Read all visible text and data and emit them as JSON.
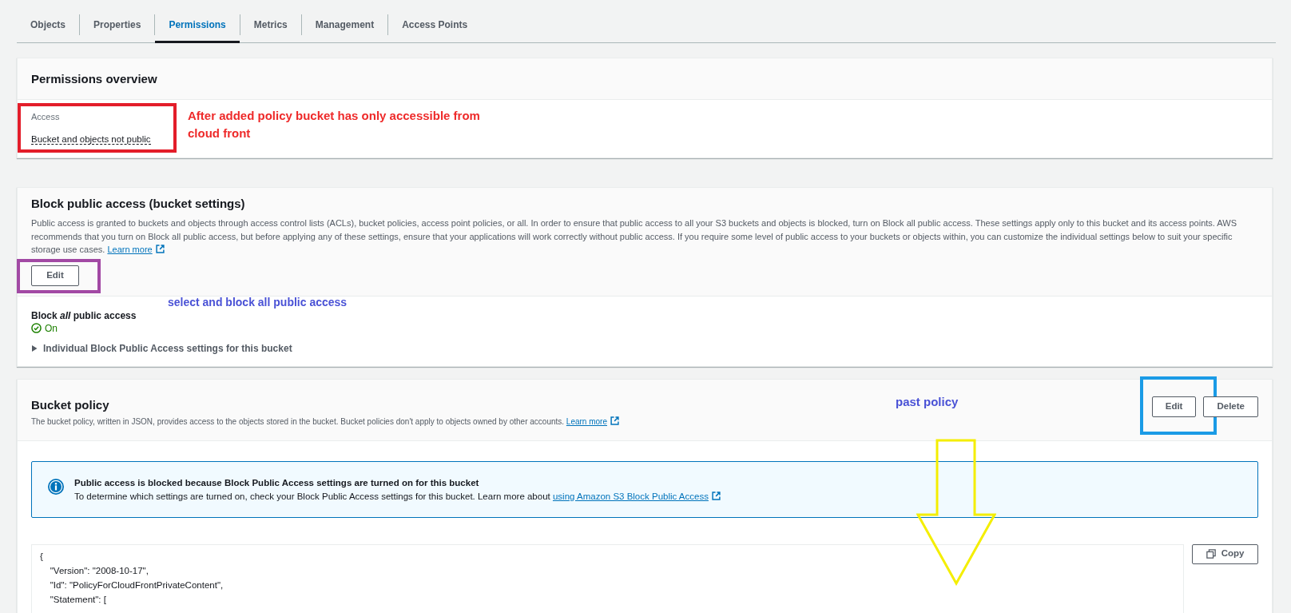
{
  "tabs": [
    {
      "label": "Objects",
      "selected": false
    },
    {
      "label": "Properties",
      "selected": false
    },
    {
      "label": "Permissions",
      "selected": true
    },
    {
      "label": "Metrics",
      "selected": false
    },
    {
      "label": "Management",
      "selected": false
    },
    {
      "label": "Access Points",
      "selected": false
    }
  ],
  "permissions_overview": {
    "title": "Permissions overview",
    "access": {
      "label": "Access",
      "value": "Bucket and objects not public"
    },
    "annotation": "After added policy bucket has only accessible from cloud front"
  },
  "block_public_access": {
    "title": "Block public access (bucket settings)",
    "description": "Public access is granted to buckets and objects through access control lists (ACLs), bucket policies, access point policies, or all. In order to ensure that public access to all your S3 buckets and objects is blocked, turn on Block all public access. These settings apply only to this bucket and its access points. AWS recommends that you turn on Block all public access, but before applying any of these settings, ensure that your applications will work correctly without public access. If you require some level of public access to your buckets or objects within, you can customize the individual settings below to suit your specific storage use cases.",
    "learn_more": "Learn more",
    "edit_button": "Edit",
    "annotation": "select and block all public access",
    "block_all": {
      "label": "Block *all* public access",
      "status": "On",
      "on": true
    },
    "individual_settings": {
      "label": "Individual Block Public Access settings for this bucket",
      "expanded": false
    }
  },
  "bucket_policy": {
    "title": "Bucket policy",
    "description": "The bucket policy, written in JSON, provides access to the objects stored in the bucket. Bucket policies don't apply to objects owned by other accounts.",
    "learn_more": "Learn more",
    "annotation": "past policy",
    "buttons": [
      "Edit",
      "Delete"
    ],
    "alert": {
      "title": "Public access is blocked because Block Public Access settings are turned on for this bucket",
      "text": "To determine which settings are turned on, check your Block Public Access settings for this bucket. Learn more about",
      "link": "using Amazon S3 Block Public Access"
    },
    "code_lines": [
      "{",
      "    \"Version\": \"2008-10-17\",",
      "    \"Id\": \"PolicyForCloudFrontPrivateContent\",",
      "    \"Statement\": ["
    ],
    "copy_button": "Copy"
  }
}
